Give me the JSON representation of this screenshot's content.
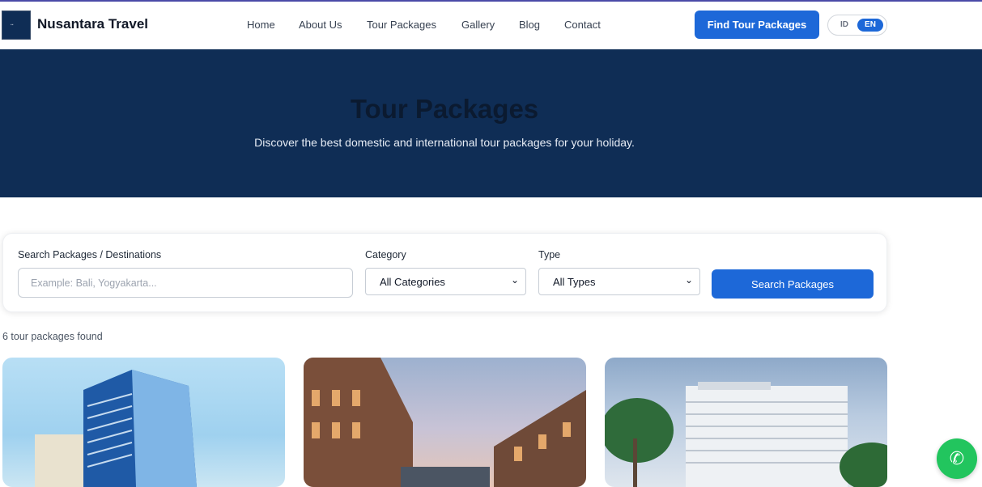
{
  "header": {
    "brand": "Nusantara Travel",
    "nav": [
      "Home",
      "About Us",
      "Tour Packages",
      "Gallery",
      "Blog",
      "Contact"
    ],
    "cta": "Find Tour Packages",
    "lang": {
      "id": "ID",
      "en": "EN",
      "active": "EN"
    }
  },
  "hero": {
    "title": "Tour Packages",
    "subtitle": "Discover the best domestic and international tour packages for your holiday."
  },
  "search": {
    "query_label": "Search Packages / Destinations",
    "query_placeholder": "Example: Bali, Yogyakarta...",
    "category_label": "Category",
    "category_value": "All Categories",
    "type_label": "Type",
    "type_value": "All Types",
    "button": "Search Packages"
  },
  "results": {
    "count_text": "6 tour packages found"
  },
  "colors": {
    "primary": "#1d68d8",
    "hero_bg": "#0f2d55",
    "whatsapp": "#22c55e"
  },
  "icons": [
    "logo-icon",
    "chevron-down-icon",
    "whatsapp-icon"
  ]
}
